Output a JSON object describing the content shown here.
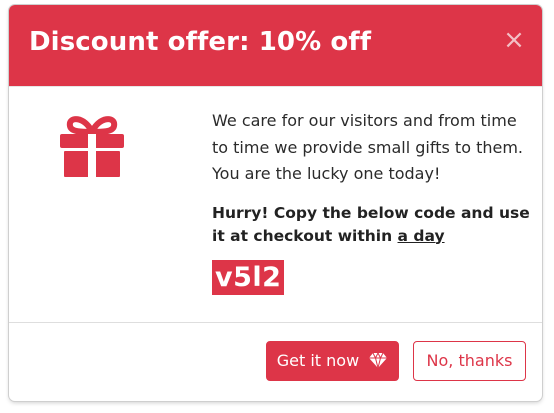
{
  "modal": {
    "title": "Discount offer: 10% off",
    "close_glyph": "×",
    "message": "We care for our visitors and from time to time we provide small gifts to them. You are the lucky one today!",
    "hurry_text": "Hurry! Copy the below code and use it at checkout within ",
    "hurry_link": "a day",
    "discount_code": "v5l2",
    "gift_icon": "gift-icon",
    "primary_button": {
      "label": "Get it now",
      "icon": "gem-icon"
    },
    "secondary_button": {
      "label": "No, thanks"
    },
    "colors": {
      "accent": "#dd3548",
      "text": "#2b2b2b",
      "background": "#ffffff"
    }
  }
}
